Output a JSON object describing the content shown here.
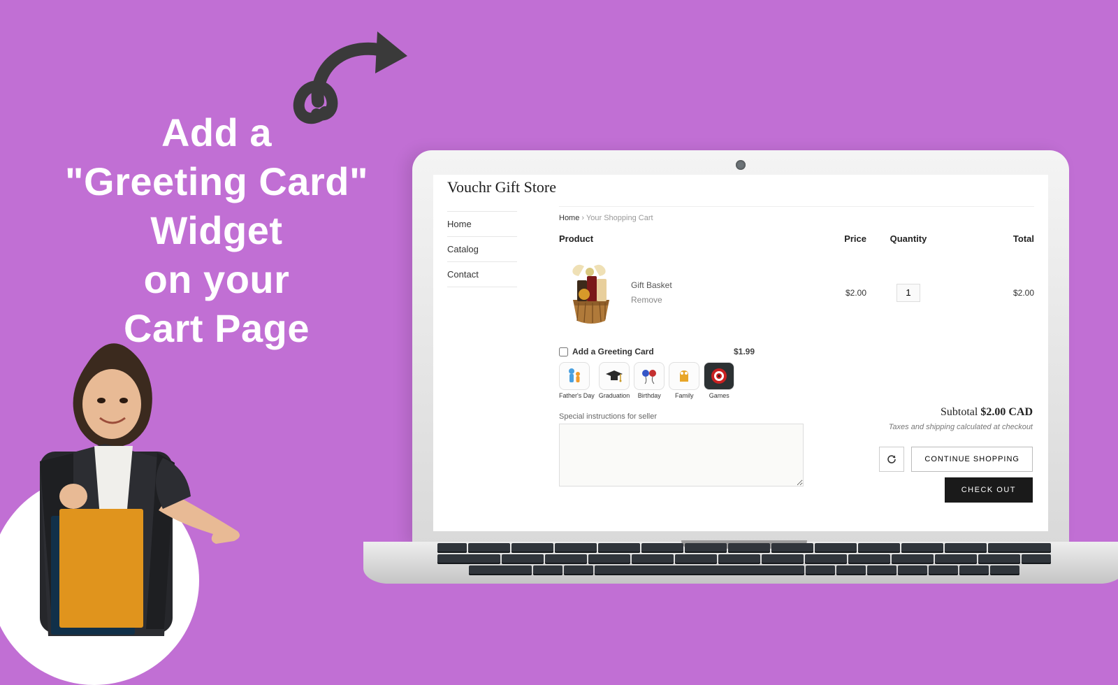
{
  "headline": {
    "l1": "Add a",
    "l2": "\"Greeting Card\"",
    "l3": "Widget",
    "l4": "on your",
    "l5": "Cart Page"
  },
  "store": {
    "name": "Vouchr Gift Store"
  },
  "nav": {
    "home": "Home",
    "catalog": "Catalog",
    "contact": "Contact"
  },
  "crumb": {
    "home": "Home",
    "sep": "›",
    "current": "Your Shopping Cart"
  },
  "table": {
    "product": "Product",
    "price": "Price",
    "qty": "Quantity",
    "total": "Total"
  },
  "item": {
    "name": "Gift Basket",
    "remove": "Remove",
    "price": "$2.00",
    "qty": "1",
    "total": "$2.00"
  },
  "gc": {
    "label": "Add a Greeting Card",
    "price": "$1.99",
    "opts": [
      {
        "label": "Father's Day",
        "id": "fathers"
      },
      {
        "label": "Graduation",
        "id": "grad"
      },
      {
        "label": "Birthday",
        "id": "bday"
      },
      {
        "label": "Family",
        "id": "family"
      },
      {
        "label": "Games",
        "id": "games"
      }
    ]
  },
  "instr": {
    "label": "Special instructions for seller"
  },
  "summary": {
    "subtotal_label": "Subtotal",
    "subtotal_value": "$2.00 CAD",
    "taxes": "Taxes and shipping calculated at checkout"
  },
  "buttons": {
    "continue": "CONTINUE SHOPPING",
    "checkout": "CHECK OUT"
  }
}
